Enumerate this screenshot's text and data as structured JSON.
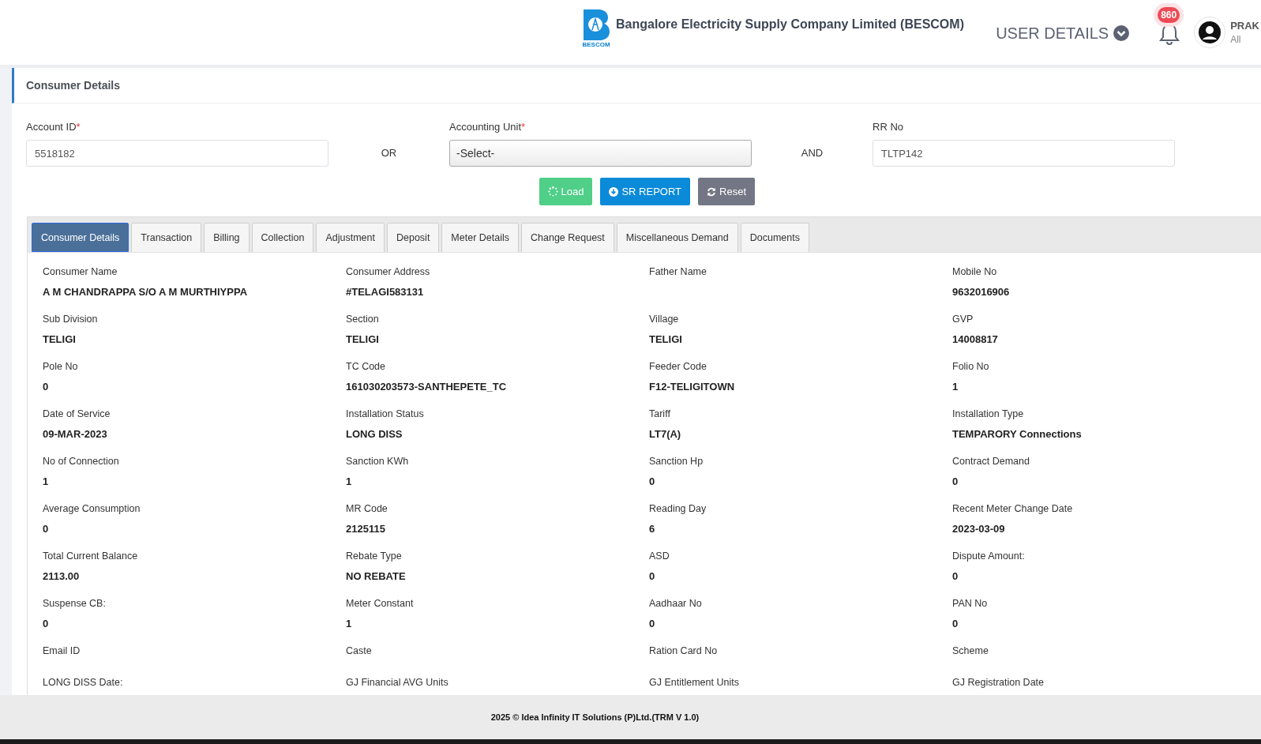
{
  "header": {
    "logo_caption": "BESCOM",
    "title": "Bangalore Electricity Supply Company Limited (BESCOM)",
    "menu_label": "USER DETAILS",
    "notification_count": "860",
    "user_name": "PRAK",
    "user_role": "All"
  },
  "page_title": "Consumer Details",
  "form": {
    "items": [
      {
        "kind": "input",
        "label": "Account ID",
        "required_mark": "*",
        "value": "5518182"
      },
      {
        "kind": "conjunction",
        "text": "OR"
      },
      {
        "kind": "select",
        "label": "Accounting Unit",
        "required_mark": "*",
        "value": "-Select-"
      },
      {
        "kind": "conjunction",
        "text": "AND"
      },
      {
        "kind": "input",
        "label": "RR No",
        "value": "TLTP142"
      }
    ],
    "buttons": [
      {
        "kind": "load",
        "label": "Load"
      },
      {
        "kind": "report",
        "label": "SR REPORT"
      },
      {
        "kind": "reset",
        "label": "Reset"
      }
    ]
  },
  "tabs": [
    {
      "label": "Consumer Details",
      "selected": true
    },
    {
      "label": "Transaction",
      "selected": false
    },
    {
      "label": "Billing",
      "selected": false
    },
    {
      "label": "Collection",
      "selected": false
    },
    {
      "label": "Adjustment",
      "selected": false
    },
    {
      "label": "Deposit",
      "selected": false
    },
    {
      "label": "Meter Details",
      "selected": false
    },
    {
      "label": "Change Request",
      "selected": false
    },
    {
      "label": "Miscellaneous Demand",
      "selected": false
    },
    {
      "label": "Documents",
      "selected": false
    }
  ],
  "details": [
    {
      "label": "Consumer Name",
      "value": "A M CHANDRAPPA S/O A M MURTHIYPPA"
    },
    {
      "label": "Consumer Address",
      "value": "#TELAGI583131"
    },
    {
      "label": "Father Name"
    },
    {
      "label": "Mobile No",
      "value": "9632016906"
    },
    {
      "label": "Sub Division",
      "value": "TELIGI"
    },
    {
      "label": "Section",
      "value": "TELIGI"
    },
    {
      "label": "Village",
      "value": "TELIGI"
    },
    {
      "label": "GVP",
      "value": "14008817"
    },
    {
      "label": "Pole No",
      "value": "0"
    },
    {
      "label": "TC Code",
      "value": "161030203573-SANTHEPETE_TC"
    },
    {
      "label": "Feeder Code",
      "value": "F12-TELIGITOWN"
    },
    {
      "label": "Folio No",
      "value": "1"
    },
    {
      "label": "Date of Service",
      "value": "09-MAR-2023"
    },
    {
      "label": "Installation Status",
      "value": "LONG DISS"
    },
    {
      "label": "Tariff",
      "value": "LT7(A)"
    },
    {
      "label": "Installation Type",
      "value": "TEMPARORY Connections"
    },
    {
      "label": "No of Connection",
      "value": "1"
    },
    {
      "label": "Sanction KWh",
      "value": "1"
    },
    {
      "label": "Sanction Hp",
      "value": "0"
    },
    {
      "label": "Contract Demand",
      "value": "0"
    },
    {
      "label": "Average Consumption",
      "value": "0"
    },
    {
      "label": "MR Code",
      "value": "2125115"
    },
    {
      "label": "Reading Day",
      "value": "6"
    },
    {
      "label": "Recent Meter Change Date",
      "value": "2023-03-09"
    },
    {
      "label": "Total Current Balance",
      "value": "2113.00"
    },
    {
      "label": "Rebate Type",
      "value": "NO REBATE"
    },
    {
      "label": "ASD",
      "value": "0"
    },
    {
      "label": "Dispute Amount:",
      "value": "0"
    },
    {
      "label": "Suspense CB:",
      "value": "0"
    },
    {
      "label": "Meter Constant",
      "value": "1"
    },
    {
      "label": "Aadhaar No",
      "value": "0"
    },
    {
      "label": "PAN No",
      "value": "0"
    },
    {
      "label": "Email ID"
    },
    {
      "label": "Caste"
    },
    {
      "label": "Ration Card No"
    },
    {
      "label": "Scheme"
    },
    {
      "label": "LONG DISS Date:"
    },
    {
      "label": "GJ Financial AVG Units"
    },
    {
      "label": "GJ Entitlement Units"
    },
    {
      "label": "GJ Registration Date"
    }
  ],
  "footer": "2025 © Idea Infinity IT Solutions (P)Ltd.(TRM V 1.0)"
}
